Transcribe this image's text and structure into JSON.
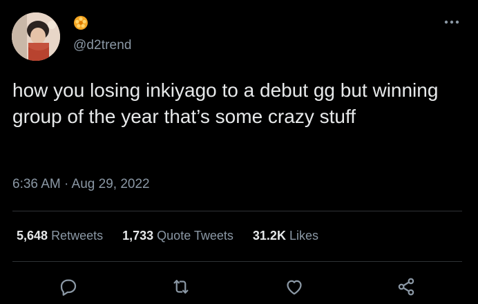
{
  "author": {
    "handle": "@d2trend",
    "avatar_icon": "profile-photo",
    "badge_icon": "orange-flower-badge-icon"
  },
  "tweet": {
    "text": "how you losing inkiyago to a debut gg but winning group of the year that’s some crazy stuff",
    "timestamp": "6:36 AM · Aug 29, 2022"
  },
  "stats": {
    "retweets_count": "5,648",
    "retweets_label": "Retweets",
    "quote_count": "1,733",
    "quote_label": "Quote Tweets",
    "likes_count": "31.2K",
    "likes_label": "Likes"
  },
  "actions": {
    "reply_icon": "reply-icon",
    "retweet_icon": "retweet-icon",
    "like_icon": "heart-icon",
    "share_icon": "share-icon"
  },
  "colors": {
    "background": "#000000",
    "text": "#e7e9ea",
    "secondary": "#8b98a5",
    "divider": "#2f3336",
    "badge": "#f5a623"
  }
}
